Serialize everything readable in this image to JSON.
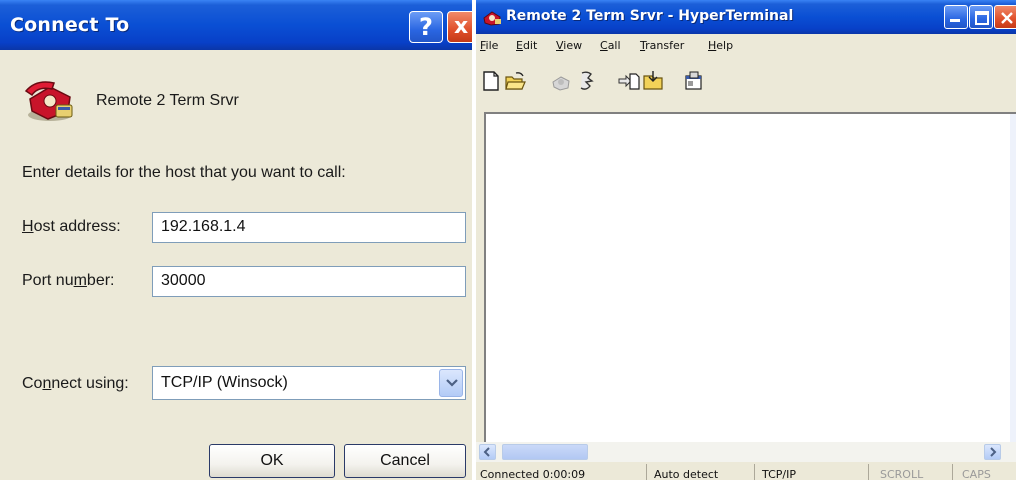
{
  "connect_dialog": {
    "title": "Connect To",
    "help_glyph": "?",
    "close_glyph": "x",
    "connection_name": "Remote 2 Term Srvr",
    "icon": "phone-icon",
    "instructions": "Enter details for the host that you want to call:",
    "host_address": {
      "label_underlined": "H",
      "label_rest": "ost address:",
      "value": "192.168.1.4"
    },
    "port_number": {
      "label_before": "Port nu",
      "label_underlined": "m",
      "label_after": "ber:",
      "value": "30000"
    },
    "connect_using": {
      "label_before": "Co",
      "label_underlined": "n",
      "label_after": "nect using:",
      "selected": "TCP/IP (Winsock)"
    },
    "ok_label": "OK",
    "cancel_label": "Cancel"
  },
  "hyperterminal": {
    "title": "Remote 2 Term Srvr - HyperTerminal",
    "menu": [
      "File",
      "Edit",
      "View",
      "Call",
      "Transfer",
      "Help"
    ],
    "toolbar_icons": [
      "new-icon",
      "open-icon",
      "connect-icon",
      "disconnect-icon",
      "send-icon",
      "receive-icon",
      "properties-icon"
    ],
    "status": {
      "connected": "Connected 0:00:09",
      "detect": "Auto detect",
      "protocol": "TCP/IP",
      "scroll": "SCROLL",
      "caps": "CAPS"
    }
  },
  "colors": {
    "titlebar_blue": "#0a4fd4",
    "window_face": "#ece9d8",
    "close_red": "#e04f2a"
  }
}
